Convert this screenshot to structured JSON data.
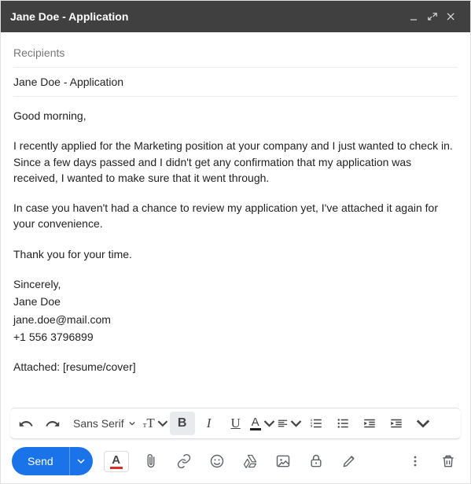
{
  "window": {
    "title": "Jane Doe - Application"
  },
  "fields": {
    "recipients_placeholder": "Recipients",
    "subject": "Jane Doe - Application"
  },
  "body": {
    "greeting": "Good morning,",
    "p1": "I recently applied for the Marketing position at your company and I just wanted to check in. Since a few days passed and I didn't get any confirmation that my application was received, I wanted to make sure that it went through.",
    "p2": "In case you haven't had a chance to review my application yet, I've attached it again for your convenience.",
    "p3": "Thank you for your time.",
    "signoff": "Sincerely,",
    "name": "Jane Doe",
    "email": "jane.doe@mail.com",
    "phone": "+1 556 3796899",
    "attached": "Attached: [resume/cover]"
  },
  "format_toolbar": {
    "font": "Sans Serif"
  },
  "actions": {
    "send_label": "Send"
  }
}
